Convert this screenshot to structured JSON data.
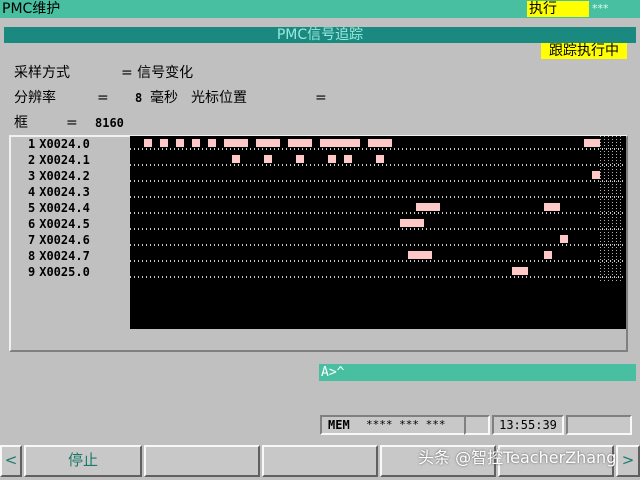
{
  "header": {
    "app_title": "PMC维护",
    "exec_label": "执行",
    "exec_stars": "***"
  },
  "screen": {
    "title": "PMC信号追踪",
    "status": "跟踪执行中"
  },
  "params": {
    "sampling": "采样方式",
    "sampling_value": "= 信号变化",
    "resolution": "分辨率",
    "resolution_eq": "=",
    "resolution_value": "8",
    "resolution_unit": "毫秒",
    "cursor_label": "光标位置",
    "cursor_eq": "=",
    "frame_label": "框",
    "frame_eq": "=",
    "frame_value": "8160"
  },
  "signals": [
    {
      "index": "1",
      "name": "X0024.0"
    },
    {
      "index": "2",
      "name": "X0024.1"
    },
    {
      "index": "3",
      "name": "X0024.2"
    },
    {
      "index": "4",
      "name": "X0024.3"
    },
    {
      "index": "5",
      "name": "X0024.4"
    },
    {
      "index": "6",
      "name": "X0024.5"
    },
    {
      "index": "7",
      "name": "X0024.6"
    },
    {
      "index": "8",
      "name": "X0024.7"
    },
    {
      "index": "9",
      "name": "X0025.0"
    }
  ],
  "command_line": "A>^",
  "status_bar": {
    "mode": "MEM",
    "stars": "**** *** ***",
    "time": "13:55:39"
  },
  "softkeys": {
    "left_arrow": "<",
    "stop": "停止",
    "right_arrow": ">"
  },
  "watermark": "头条 @智控TeacherZhang",
  "colors": {
    "header_bg": "#48bfa0",
    "title_bar_bg": "#1a8a80",
    "highlight": "#ffff00",
    "trace_bg": "#000000",
    "pulse": "#ffc8c8"
  }
}
